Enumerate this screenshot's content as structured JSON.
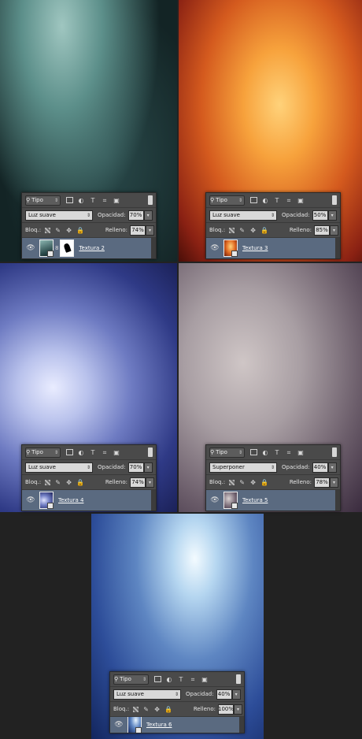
{
  "panels": [
    {
      "filter_label": "Tipo",
      "blend_mode": "Luz suave",
      "opacity_label": "Opacidad:",
      "opacity": "70%",
      "lock_label": "Bloq.:",
      "fill_label": "Relleno:",
      "fill": "74%",
      "layer_name": "Textura 2",
      "has_mask": true
    },
    {
      "filter_label": "Tipo",
      "blend_mode": "Luz suave",
      "opacity_label": "Opacidad:",
      "opacity": "50%",
      "lock_label": "Bloq.:",
      "fill_label": "Relleno:",
      "fill": "85%",
      "layer_name": "Textura 3",
      "has_mask": false
    },
    {
      "filter_label": "Tipo",
      "blend_mode": "Luz suave",
      "opacity_label": "Opacidad:",
      "opacity": "70%",
      "lock_label": "Bloq.:",
      "fill_label": "Relleno:",
      "fill": "74%",
      "layer_name": "Textura 4",
      "has_mask": false
    },
    {
      "filter_label": "Tipo",
      "blend_mode": "Superponer",
      "opacity_label": "Opacidad:",
      "opacity": "40%",
      "lock_label": "Bloq.:",
      "fill_label": "Relleno:",
      "fill": "78%",
      "layer_name": "Textura 5",
      "has_mask": false
    },
    {
      "filter_label": "Tipo",
      "blend_mode": "Luz suave",
      "opacity_label": "Opacidad:",
      "opacity": "40%",
      "lock_label": "Bloq.:",
      "fill_label": "Relleno:",
      "fill": "100%",
      "layer_name": "Textura 6",
      "has_mask": false
    }
  ],
  "colors": {
    "panel_bg": "#4a4a4a",
    "layer_row_selected": "#5a6a80",
    "page_bg": "#222222"
  },
  "icons": {
    "filter": "search-icon",
    "kind_filters": [
      "image-icon",
      "adjustment-icon",
      "type-icon",
      "shape-icon",
      "smart-object-icon"
    ],
    "locks": [
      "lock-transparent-icon",
      "lock-paint-icon",
      "lock-position-icon",
      "lock-all-icon"
    ],
    "visibility": "eye-icon"
  }
}
